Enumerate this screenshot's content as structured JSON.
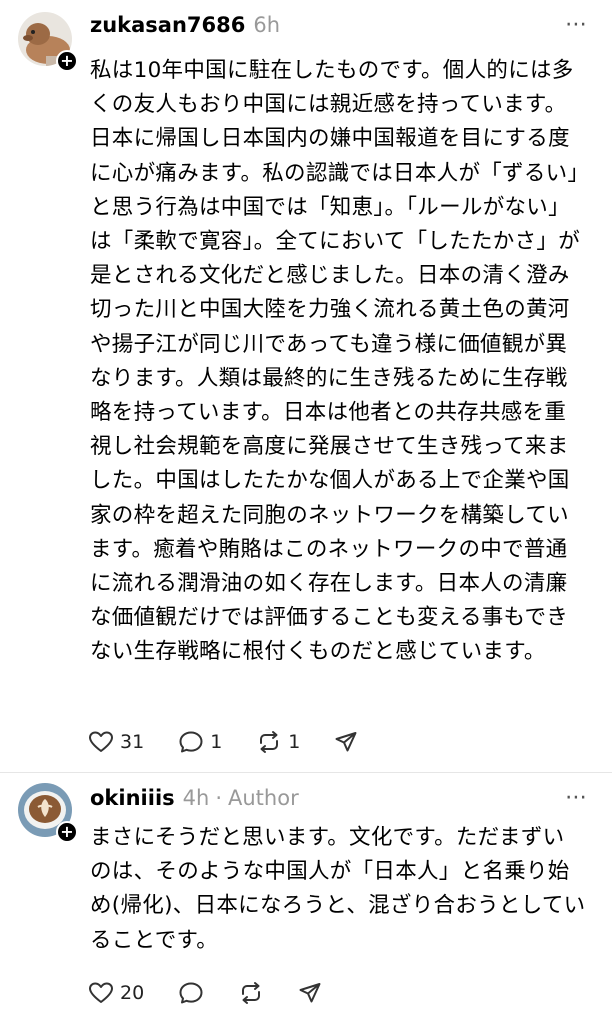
{
  "posts": [
    {
      "username": "zukasan7686",
      "time": "6h",
      "text": "私は10年中国に駐在したものです。個人的には多くの友人もおり中国には親近感を持っています。日本に帰国し日本国内の嫌中国報道を目にする度に心が痛みます。私の認識では日本人が「ずるい」と思う行為は中国では「知恵」。「ルールがない」は「柔軟で寛容」。全てにおいて「したたかさ」が是とされる文化だと感じました。日本の清く澄み切った川と中国大陸を力強く流れる黄土色の黄河や揚子江が同じ川であっても違う様に価値観が異なります。人類は最終的に生き残るために生存戦略を持っています。日本は他者との共存共感を重視し社会規範を高度に発展させて生き残って来ました。中国はしたたかな個人がある上で企業や国家の枠を超えた同胞のネットワークを構築しています。癒着や賄賂はこのネットワークの中で普通に流れる潤滑油の如く存在します。日本人の清廉な価値観だけでは評価することも変える事もできない生存戦略に根付くものだと感じています。",
      "likes": "31",
      "replies": "1",
      "reposts": "1"
    },
    {
      "username": "okiniiis",
      "time": "4h",
      "separator": "·",
      "author_badge": "Author",
      "text": "まさにそうだと思います。文化です。ただまずいのは、そのような中国人が「日本人」と名乗り始め(帰化)、日本になろうと、混ざり合おうとしていることです。",
      "likes": "20"
    }
  ],
  "more_icon": "⋯",
  "follow_icon": "+",
  "icons": [
    "heart-icon",
    "comment-icon",
    "repost-icon",
    "share-icon",
    "more-icon",
    "plus-icon"
  ]
}
